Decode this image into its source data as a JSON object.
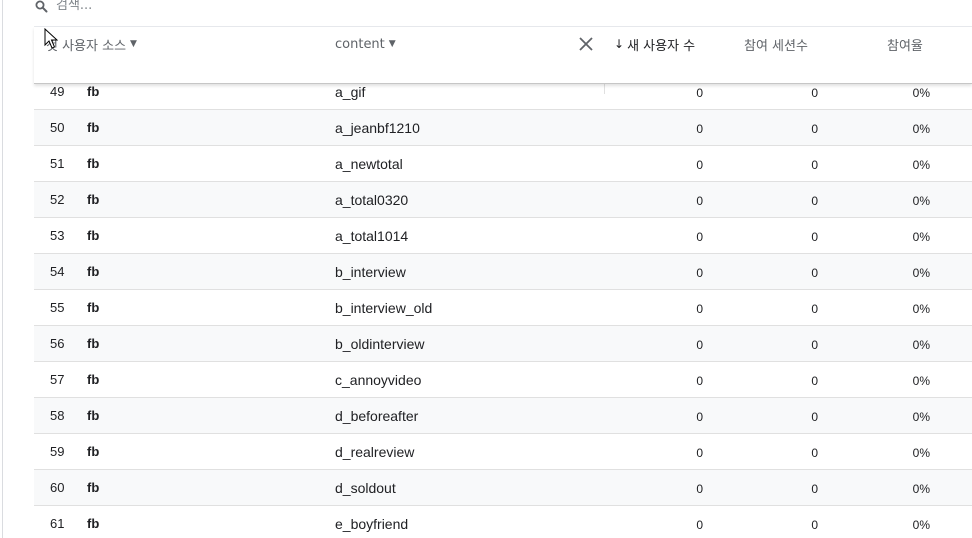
{
  "search": {
    "placeholder": "검색..."
  },
  "header": {
    "col_source": "첫 사용자 소스",
    "col_content": "content",
    "col_new_users": "새 사용자 수",
    "col_sessions": "참여 세션수",
    "col_rate": "참여율",
    "sort_direction": "descending"
  },
  "rows": [
    {
      "idx": "49",
      "source": "fb",
      "content": "a_gif",
      "new_users": "0",
      "sessions": "0",
      "rate": "0%"
    },
    {
      "idx": "50",
      "source": "fb",
      "content": "a_jeanbf1210",
      "new_users": "0",
      "sessions": "0",
      "rate": "0%"
    },
    {
      "idx": "51",
      "source": "fb",
      "content": "a_newtotal",
      "new_users": "0",
      "sessions": "0",
      "rate": "0%"
    },
    {
      "idx": "52",
      "source": "fb",
      "content": "a_total0320",
      "new_users": "0",
      "sessions": "0",
      "rate": "0%"
    },
    {
      "idx": "53",
      "source": "fb",
      "content": "a_total1014",
      "new_users": "0",
      "sessions": "0",
      "rate": "0%"
    },
    {
      "idx": "54",
      "source": "fb",
      "content": "b_interview",
      "new_users": "0",
      "sessions": "0",
      "rate": "0%"
    },
    {
      "idx": "55",
      "source": "fb",
      "content": "b_interview_old",
      "new_users": "0",
      "sessions": "0",
      "rate": "0%"
    },
    {
      "idx": "56",
      "source": "fb",
      "content": "b_oldinterview",
      "new_users": "0",
      "sessions": "0",
      "rate": "0%"
    },
    {
      "idx": "57",
      "source": "fb",
      "content": "c_annoyvideo",
      "new_users": "0",
      "sessions": "0",
      "rate": "0%"
    },
    {
      "idx": "58",
      "source": "fb",
      "content": "d_beforeafter",
      "new_users": "0",
      "sessions": "0",
      "rate": "0%"
    },
    {
      "idx": "59",
      "source": "fb",
      "content": "d_realreview",
      "new_users": "0",
      "sessions": "0",
      "rate": "0%"
    },
    {
      "idx": "60",
      "source": "fb",
      "content": "d_soldout",
      "new_users": "0",
      "sessions": "0",
      "rate": "0%"
    },
    {
      "idx": "61",
      "source": "fb",
      "content": "e_boyfriend",
      "new_users": "0",
      "sessions": "0",
      "rate": "0%"
    }
  ],
  "icons": {
    "search": "search-icon",
    "close": "close-icon",
    "sort": "arrow-down-icon",
    "dropdown": "caret-down-icon",
    "cursor": "mouse-pointer-icon"
  }
}
